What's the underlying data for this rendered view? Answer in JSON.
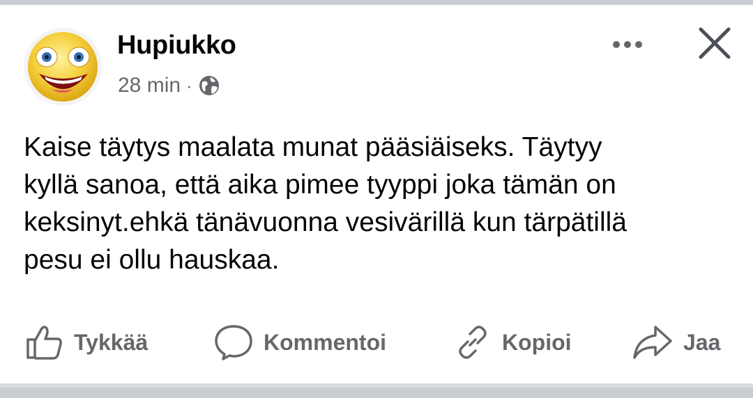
{
  "post": {
    "author": "Hupiukko",
    "time": "28 min",
    "separator": "·",
    "privacy_icon": "globe-icon",
    "text": "Kaise täytys maalata munat pääsiäiseks. Täytyy\nkyllä sanoa, että aika pimee tyyppi joka tämän on\nkeksinyt.ehkä tänävuonna vesivärillä kun tärpätillä\npesu ei ollu hauskaa."
  },
  "header": {
    "more_icon": "more-horizontal-icon",
    "close_icon": "close-icon"
  },
  "actions": [
    {
      "label": "Tykkää",
      "icon": "thumbs-up-icon"
    },
    {
      "label": "Kommentoi",
      "icon": "comment-bubble-icon"
    },
    {
      "label": "Kopioi",
      "icon": "link-icon"
    },
    {
      "label": "Jaa",
      "icon": "share-arrow-icon"
    }
  ],
  "colors": {
    "text_primary": "#050505",
    "text_secondary": "#65676b",
    "divider": "#c9ccd1"
  }
}
